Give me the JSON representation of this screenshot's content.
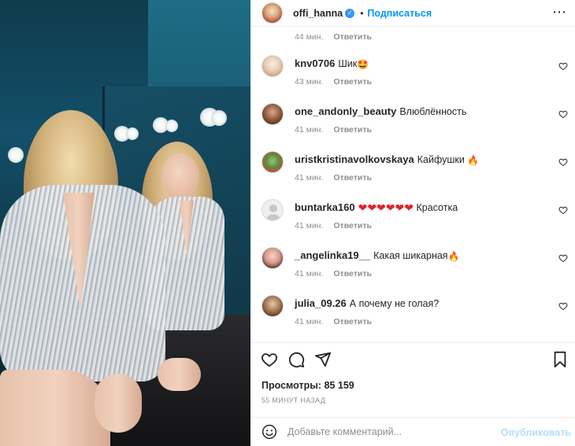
{
  "post": {
    "author": "offi_hanna",
    "verified": true,
    "separator": "•",
    "follow_label": "Подписаться",
    "more_label": "⋯"
  },
  "first_meta": {
    "time": "44 мин.",
    "reply": "Ответить"
  },
  "comments": [
    {
      "username": "knv0706",
      "text": "Шик",
      "emoji": "🤩",
      "time": "43 мин.",
      "reply": "Ответить"
    },
    {
      "username": "one_andonly_beauty",
      "text": "Влюблённость",
      "emoji": "",
      "time": "41 мин.",
      "reply": "Ответить"
    },
    {
      "username": "uristkristinavolkovskaya",
      "text": "Кайфушки",
      "emoji": "🔥",
      "time": "41 мин.",
      "reply": "Ответить"
    },
    {
      "username": "buntarka160",
      "text": "Красотка",
      "emoji": "❤❤❤❤❤❤",
      "time": "41 мин.",
      "reply": "Ответить"
    },
    {
      "username": "_angelinka19__",
      "text": "Какая шикарная",
      "emoji": "🔥",
      "time": "41 мин.",
      "reply": "Ответить"
    },
    {
      "username": "julia_09.26",
      "text": "А почему не голая?",
      "emoji": "",
      "time": "41 мин.",
      "reply": "Ответить"
    }
  ],
  "stats": {
    "views_label": "Просмотры:",
    "views_count": "85 159",
    "time_ago": "55 МИНУТ НАЗАД"
  },
  "composer": {
    "placeholder": "Добавьте комментарий...",
    "publish_label": "Опубликовать"
  },
  "icons": {
    "like": "heart-outline-icon",
    "comment": "speech-bubble-icon",
    "share": "paper-plane-icon",
    "save": "bookmark-icon",
    "emoji": "smiley-icon"
  },
  "colors": {
    "accent": "#0095f6",
    "publish_disabled": "#b2dffc",
    "muted": "#8e8e8e",
    "text": "#262626",
    "verified": "#3897f0"
  }
}
